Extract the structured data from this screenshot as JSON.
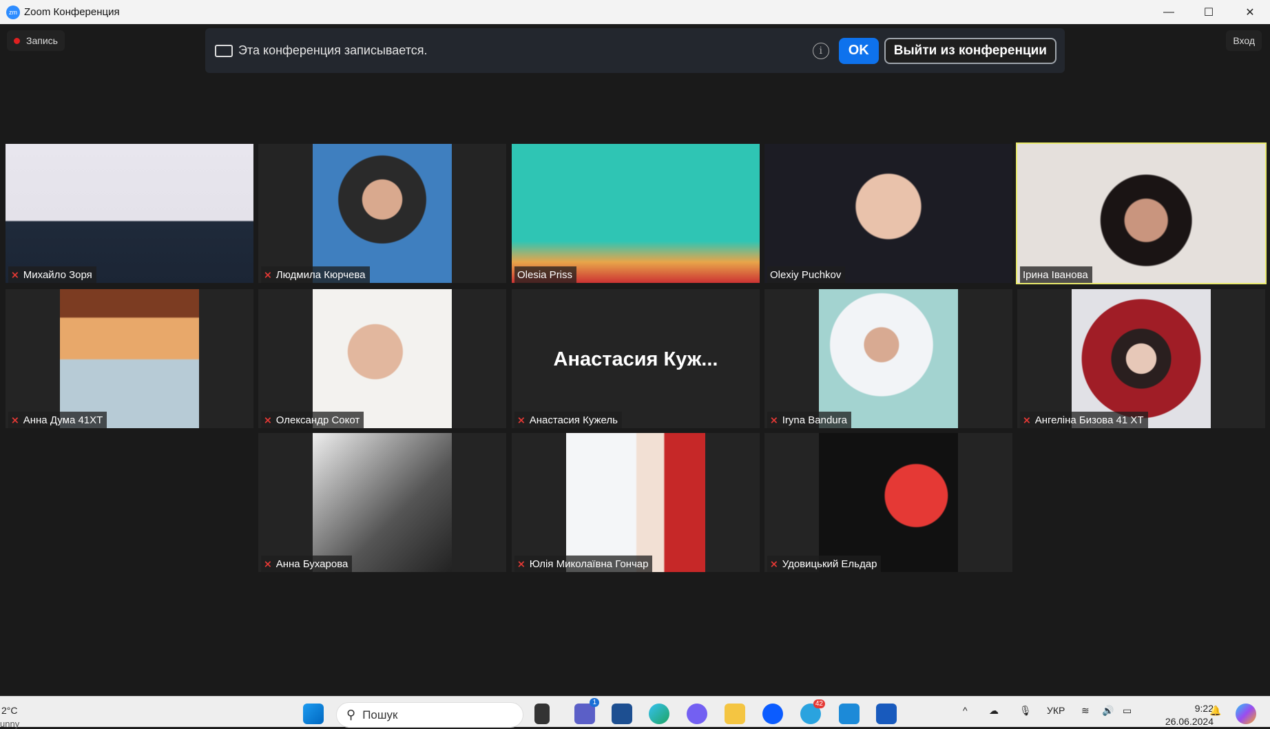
{
  "window": {
    "title": "Zoom Конференция",
    "logo": "zm"
  },
  "top": {
    "recording_label": "Запись",
    "login_label": "Вход"
  },
  "banner": {
    "message": "Эта конференция записывается.",
    "info_icon": "i",
    "ok_label": "OK",
    "leave_label": "Выйти из конференции"
  },
  "colors": {
    "accent": "#0e72ed",
    "active_speaker": "#e9ea6c",
    "muted": "#e53935"
  },
  "participants": [
    {
      "name": "Михайло Зоря",
      "muted": true
    },
    {
      "name": "Людмила Кюрчева",
      "muted": true
    },
    {
      "name": "Olesia Priss",
      "muted": false
    },
    {
      "name": "Olexiy Puchkov",
      "muted": false
    },
    {
      "name": "Ірина Іванова",
      "muted": false,
      "active": true
    },
    {
      "name": "Анна Дума 41ХТ",
      "muted": true
    },
    {
      "name": "Олександр Сокот",
      "muted": true
    },
    {
      "name": "Анастасия Кужель",
      "muted": true,
      "display": "Анастасия  Куж..."
    },
    {
      "name": "Iryna Bandura",
      "muted": true
    },
    {
      "name": "Ангеліна Бизова 41 ХТ",
      "muted": true
    },
    {
      "name": "Анна Бухарова",
      "muted": true
    },
    {
      "name": "Юлія Миколаївна Гончар",
      "muted": true
    },
    {
      "name": "Удовицький Ельдар",
      "muted": true
    }
  ],
  "taskbar": {
    "weather_temp": "2°C",
    "weather_text": "unny",
    "search_placeholder": "Пошук",
    "teams_badge": "1",
    "telegram_badge": "42",
    "language": "УКР",
    "time": "9:22",
    "date": "26.06.2024"
  }
}
